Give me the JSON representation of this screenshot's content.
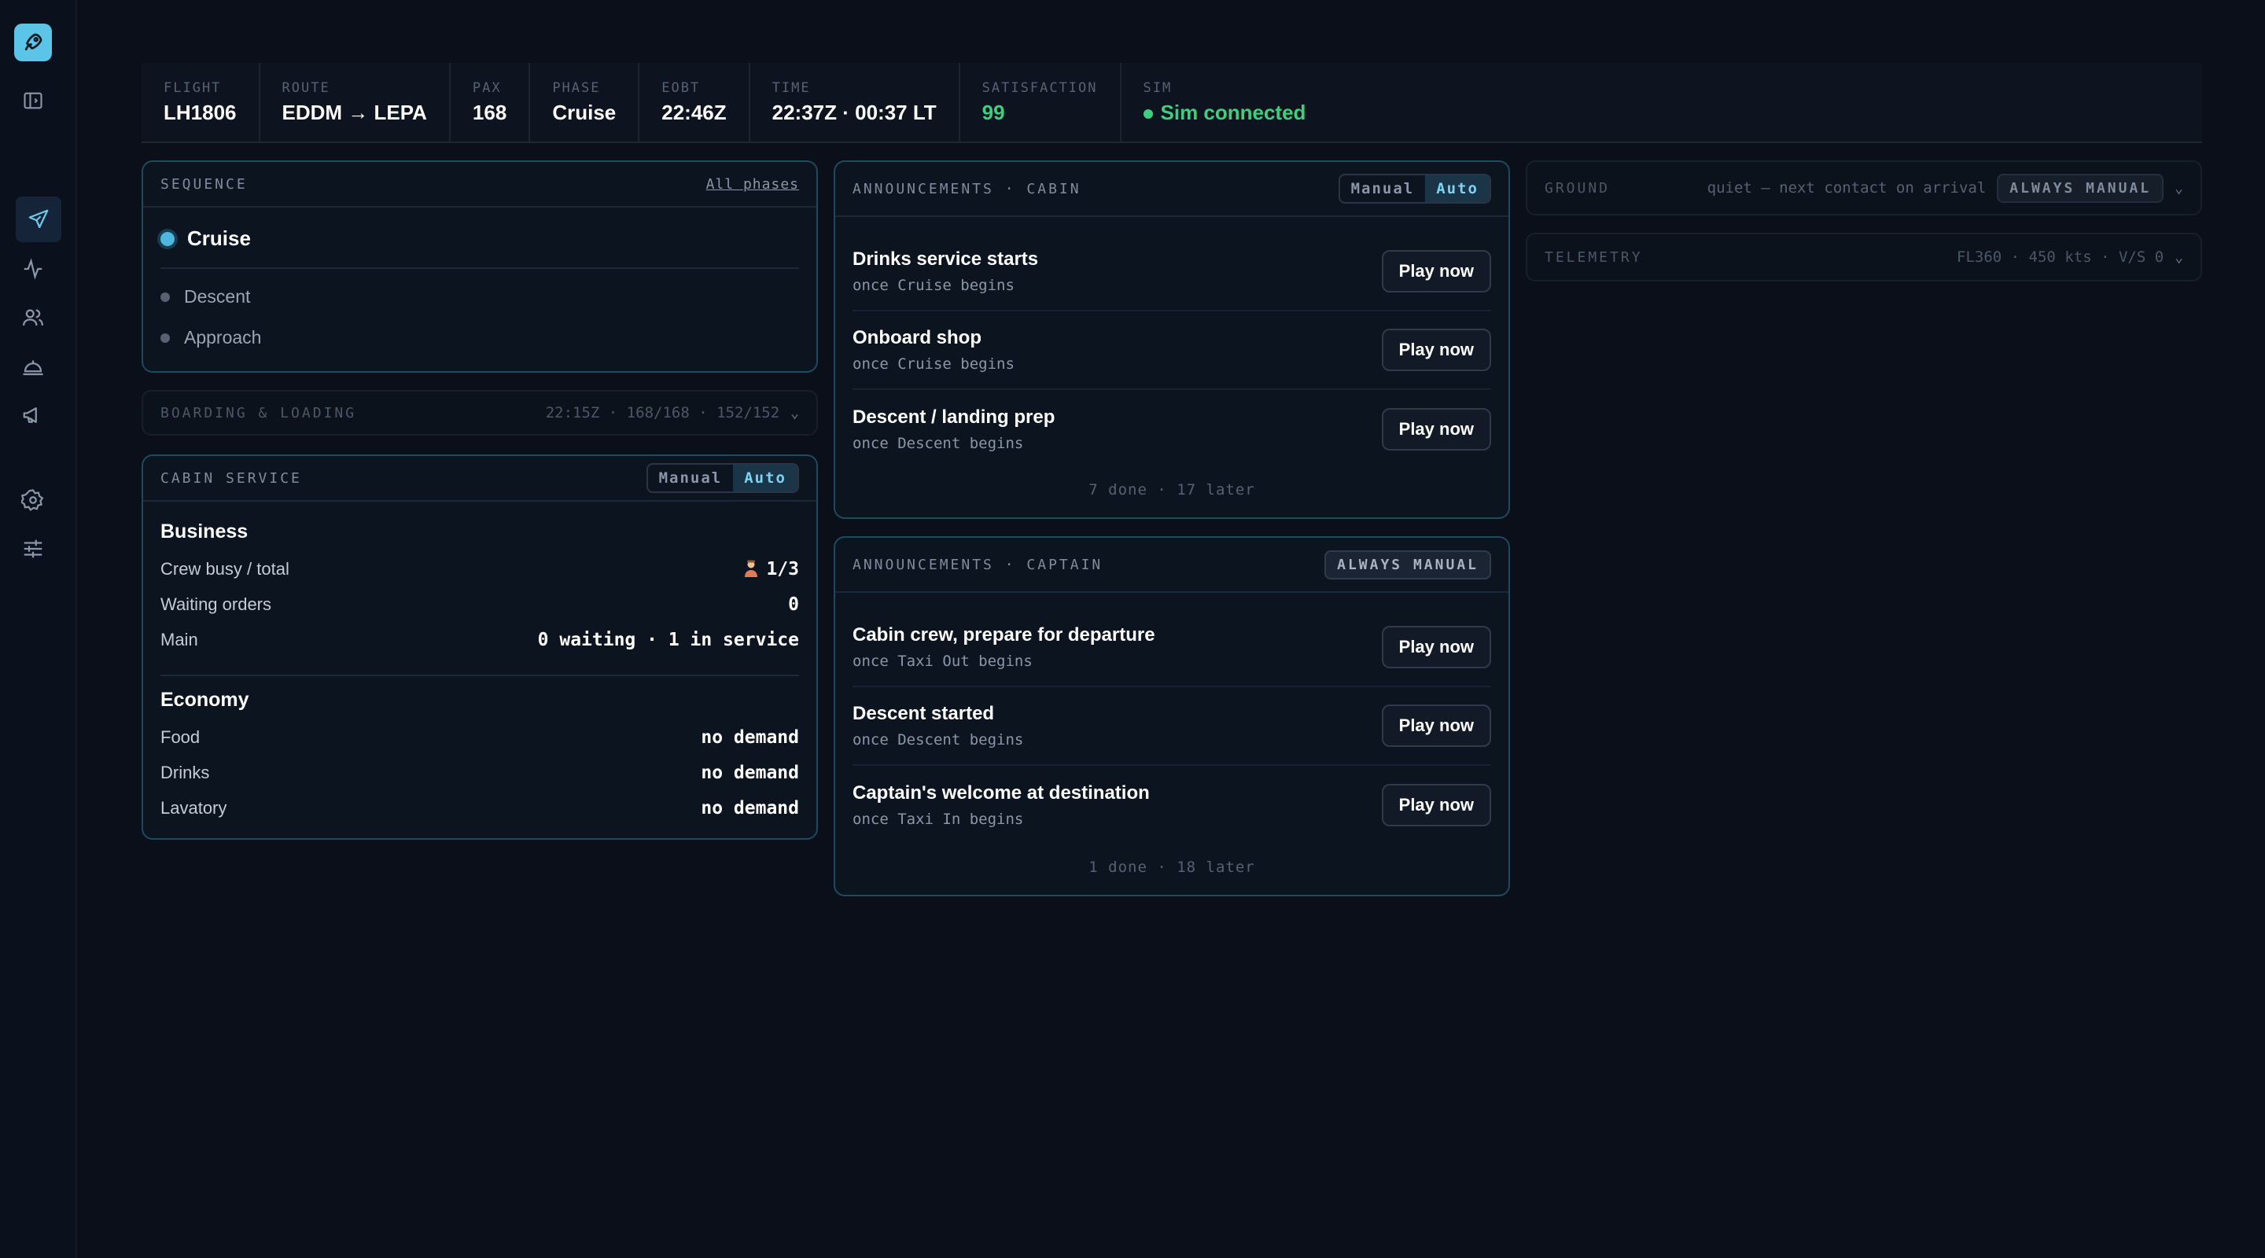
{
  "topbar": {
    "stats": [
      {
        "label": "FLIGHT",
        "value": "LH1806"
      },
      {
        "label": "ROUTE",
        "value": "EDDM → LEPA"
      },
      {
        "label": "PAX",
        "value": "168"
      },
      {
        "label": "PHASE",
        "value": "Cruise"
      },
      {
        "label": "EOBT",
        "value": "22:46Z"
      },
      {
        "label": "TIME",
        "value": "22:37Z · 00:37 LT"
      },
      {
        "label": "SATISFACTION",
        "value": "99"
      },
      {
        "label": "SIM",
        "value": "Sim connected"
      }
    ]
  },
  "sidebar": {
    "items": [
      "rocket-logo",
      "panel-toggle",
      "flight",
      "activity",
      "passengers",
      "service",
      "announcements",
      "settings",
      "sliders"
    ]
  },
  "sequence": {
    "title": "SEQUENCE",
    "link": "All phases",
    "current": "Cruise",
    "upcoming": [
      "Descent",
      "Approach"
    ]
  },
  "boarding": {
    "label": "BOARDING & LOADING",
    "meta": "22:15Z · 168/168 · 152/152"
  },
  "cabin_service": {
    "title": "CABIN SERVICE",
    "toggle": {
      "manual": "Manual",
      "auto": "Auto",
      "selected": "Auto"
    },
    "business": {
      "heading": "Business",
      "rows": [
        {
          "k": "Crew busy / total",
          "v": "1/3"
        },
        {
          "k": "Waiting orders",
          "v": "0"
        },
        {
          "k": "Main",
          "v": "0 waiting · 1 in service"
        }
      ]
    },
    "economy": {
      "heading": "Economy",
      "rows": [
        {
          "k": "Food",
          "v": "no demand"
        },
        {
          "k": "Drinks",
          "v": "no demand"
        },
        {
          "k": "Lavatory",
          "v": "no demand"
        }
      ]
    }
  },
  "ann_cabin": {
    "title": "ANNOUNCEMENTS · CABIN",
    "toggle": {
      "manual": "Manual",
      "auto": "Auto",
      "selected": "Auto"
    },
    "items": [
      {
        "title": "Drinks service starts",
        "sub": "once Cruise begins",
        "button": "Play now"
      },
      {
        "title": "Onboard shop",
        "sub": "once Cruise begins",
        "button": "Play now"
      },
      {
        "title": "Descent / landing prep",
        "sub": "once Descent begins",
        "button": "Play now"
      }
    ],
    "footer": "7 done · 17 later"
  },
  "ann_captain": {
    "title": "ANNOUNCEMENTS · CAPTAIN",
    "badge": "ALWAYS MANUAL",
    "items": [
      {
        "title": "Cabin crew, prepare for departure",
        "sub": "once Taxi Out begins",
        "button": "Play now"
      },
      {
        "title": "Descent started",
        "sub": "once Descent begins",
        "button": "Play now"
      },
      {
        "title": "Captain's welcome at destination",
        "sub": "once Taxi In begins",
        "button": "Play now"
      }
    ],
    "footer": "1 done · 18 later"
  },
  "ground": {
    "label": "GROUND",
    "note": "quiet — next contact on arrival",
    "badge": "ALWAYS MANUAL"
  },
  "telemetry": {
    "label": "TELEMETRY",
    "meta": "FL360 · 450 kts · V/S 0"
  },
  "colors": {
    "background": "#0a0f1a",
    "accent": "#5cc4e6",
    "card_border": "#1e4a5e",
    "connected": "#3ecf7e"
  }
}
